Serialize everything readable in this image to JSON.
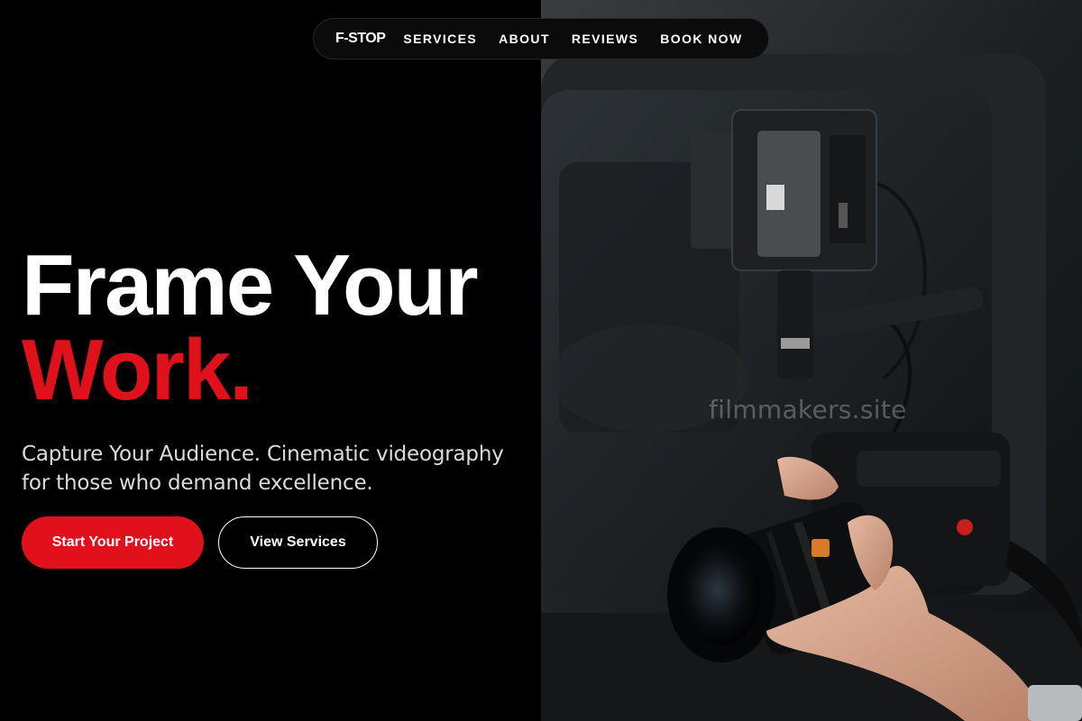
{
  "nav": {
    "logo": "F-STOP",
    "links": [
      "SERVICES",
      "ABOUT",
      "REVIEWS",
      "BOOK NOW"
    ]
  },
  "hero": {
    "headline_line1": "Frame Your",
    "headline_line2": "Work.",
    "subheading": "Capture Your Audience. Cinematic videography for those who demand excellence.",
    "primary_cta": "Start Your Project",
    "secondary_cta": "View Services"
  },
  "image": {
    "watermark": "filmmakers.site",
    "subject": "camera-rig-photo"
  },
  "colors": {
    "accent": "#e0111b",
    "background": "#000000",
    "text": "#ffffff"
  }
}
